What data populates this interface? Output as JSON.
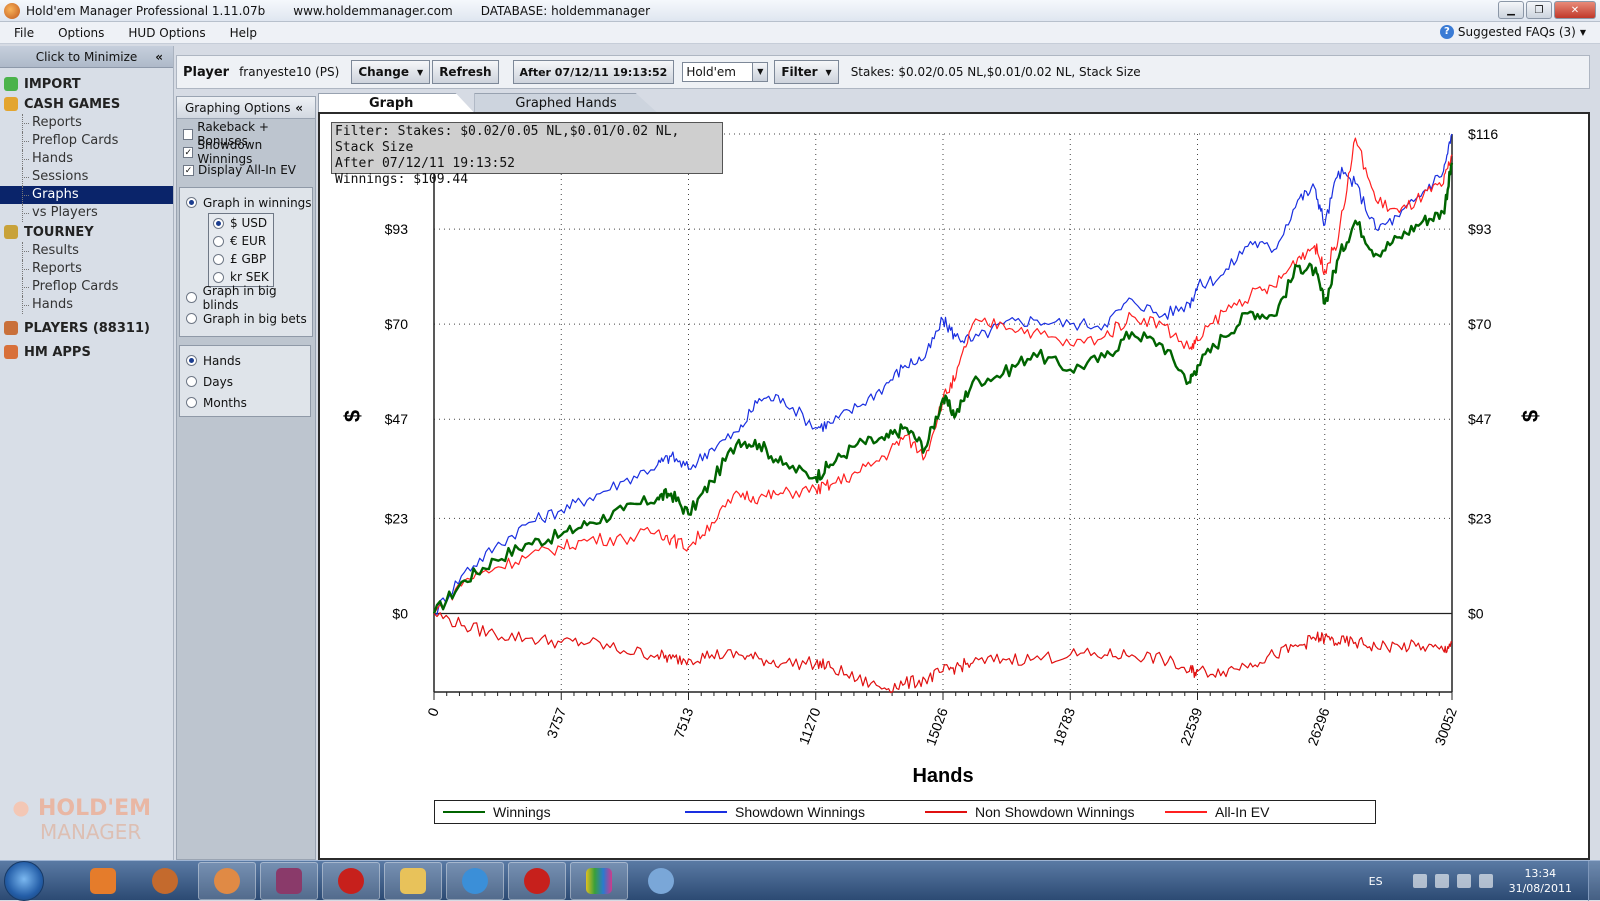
{
  "window": {
    "title": "Hold'em Manager Professional 1.11.07b",
    "website": "www.holdemmanager.com",
    "database": "DATABASE: holdemmanager"
  },
  "menu": {
    "items": [
      "File",
      "Options",
      "HUD Options",
      "Help"
    ],
    "faqs": "Suggested FAQs (3)"
  },
  "nav": {
    "minimize": "Click to Minimize",
    "import": "IMPORT",
    "cash_games": "CASH GAMES",
    "cash_items": [
      "Reports",
      "Preflop Cards",
      "Hands",
      "Sessions",
      "Graphs",
      "vs Players"
    ],
    "tourney": "TOURNEY",
    "tourney_items": [
      "Results",
      "Reports",
      "Preflop Cards",
      "Hands"
    ],
    "players": "PLAYERS (88311)",
    "hm_apps": "HM APPS",
    "logo_line1": "HOLD'EM",
    "logo_line2": "MANAGER"
  },
  "toolbar": {
    "player_label": "Player",
    "player_name": "franyeste10 (PS)",
    "change": "Change",
    "refresh": "Refresh",
    "date_filter": "After 07/12/11 19:13:52",
    "game": "Hold'em",
    "filter": "Filter",
    "stakes_text": "Stakes: $0.02/0.05 NL,$0.01/0.02 NL, Stack Size"
  },
  "graph_options": {
    "title": "Graphing Options",
    "checkboxes": [
      {
        "label": "Rakeback + Bonuses",
        "checked": false
      },
      {
        "label": "Showdown Winnings",
        "checked": true
      },
      {
        "label": "Display All-In EV",
        "checked": true
      }
    ],
    "graph_in_winnings": "Graph in winnings",
    "currencies": [
      "$ USD",
      "€ EUR",
      "£ GBP",
      "kr SEK"
    ],
    "graph_in_bb": "Graph in big blinds",
    "graph_in_bets": "Graph in big bets",
    "x_units": [
      "Hands",
      "Days",
      "Months"
    ]
  },
  "tabs": [
    "Graph",
    "Graphed Hands"
  ],
  "info_box": {
    "line1": "Filter: Stakes: $0.02/0.05 NL,$0.01/0.02 NL, Stack Size",
    "line2": "After 07/12/11 19:13:52",
    "line3": "Winnings: $109.44"
  },
  "chart_data": {
    "type": "line",
    "xlabel": "Hands",
    "ylabel": "$",
    "x_ticks": [
      0,
      3757,
      7513,
      11270,
      15026,
      18783,
      22539,
      26296,
      30052
    ],
    "y_ticks": [
      "$0",
      "$23",
      "$47",
      "$70",
      "$93",
      "$116"
    ],
    "y_tick_values": [
      0,
      23,
      47,
      70,
      93,
      116
    ],
    "xlim": [
      0,
      30052
    ],
    "ylim": [
      -19,
      116
    ],
    "grid": true,
    "legend_position": "bottom",
    "series": [
      {
        "name": "Winnings",
        "color": "#006400",
        "x": [
          0,
          900,
          1800,
          2800,
          3757,
          4600,
          5600,
          6600,
          7000,
          7513,
          8200,
          9000,
          9600,
          10300,
          11270,
          11700,
          12500,
          13300,
          13900,
          14500,
          15026,
          15400,
          15900,
          16800,
          17700,
          18783,
          19800,
          20600,
          21500,
          22300,
          22539,
          23300,
          24100,
          24800,
          25500,
          26000,
          26296,
          26700,
          27200,
          27800,
          28500,
          29200,
          29800,
          30052
        ],
        "y": [
          0,
          8,
          13,
          17,
          19,
          22,
          25,
          28,
          29,
          24,
          32,
          42,
          41,
          36,
          33,
          36,
          41,
          42,
          45,
          40,
          52,
          48,
          56,
          58,
          63,
          59,
          62,
          68,
          65,
          56,
          60,
          67,
          73,
          72,
          84,
          83,
          75,
          86,
          95,
          87,
          91,
          95,
          97,
          109
        ]
      },
      {
        "name": "Showdown Winnings",
        "color": "#1a2fe0",
        "x": [
          0,
          900,
          1800,
          2800,
          3757,
          4600,
          5600,
          6600,
          7000,
          7513,
          8200,
          9000,
          9600,
          10300,
          11270,
          11700,
          12500,
          13300,
          13900,
          14500,
          15026,
          15400,
          15900,
          16800,
          17700,
          18783,
          19800,
          20600,
          21500,
          22300,
          22539,
          23300,
          24100,
          24800,
          25500,
          26000,
          26296,
          26700,
          27200,
          27800,
          28500,
          29200,
          29800,
          30052
        ],
        "y": [
          0,
          10,
          16,
          22,
          25,
          28,
          32,
          36,
          38,
          35,
          40,
          44,
          52,
          52,
          45,
          46,
          50,
          55,
          60,
          62,
          71,
          67,
          66,
          70,
          71,
          70,
          70,
          76,
          72,
          75,
          79,
          82,
          90,
          88,
          100,
          103,
          94,
          107,
          104,
          93,
          96,
          102,
          107,
          116
        ]
      },
      {
        "name": "Non Showdown Winnings",
        "color": "#e01010",
        "x": [
          0,
          900,
          1800,
          2800,
          3757,
          4600,
          5600,
          6600,
          7000,
          7513,
          8200,
          9000,
          9600,
          10300,
          11270,
          11700,
          12500,
          13300,
          13900,
          14500,
          15026,
          15400,
          15900,
          16800,
          17700,
          18783,
          19800,
          20600,
          21500,
          22300,
          22539,
          23300,
          24100,
          24800,
          25500,
          26000,
          26296,
          26700,
          27200,
          27800,
          28500,
          29200,
          29800,
          30052
        ],
        "y": [
          0,
          -3,
          -5,
          -6,
          -7,
          -7,
          -9,
          -10,
          -11,
          -11,
          -10,
          -10,
          -11,
          -12,
          -12,
          -13,
          -16,
          -18,
          -17,
          -16,
          -14,
          -13,
          -12,
          -11,
          -11,
          -10,
          -10,
          -10,
          -11,
          -14,
          -14,
          -14,
          -12,
          -10,
          -8,
          -6,
          -6,
          -7,
          -7,
          -8,
          -8,
          -8,
          -9,
          -7
        ]
      },
      {
        "name": "All-In EV",
        "color": "#ff2020",
        "x": [
          0,
          900,
          1800,
          2800,
          3757,
          4600,
          5600,
          6600,
          7000,
          7513,
          8200,
          9000,
          9600,
          10300,
          11270,
          11700,
          12500,
          13300,
          13900,
          14500,
          15026,
          15400,
          15900,
          16800,
          17700,
          18783,
          19800,
          20600,
          21500,
          22300,
          22539,
          23300,
          24100,
          24800,
          25500,
          26000,
          26296,
          26700,
          27200,
          27800,
          28500,
          29200,
          29800,
          30052
        ],
        "y": [
          0,
          8,
          11,
          14,
          16,
          18,
          18,
          20,
          18,
          16,
          22,
          29,
          28,
          29,
          30,
          31,
          34,
          38,
          43,
          38,
          52,
          57,
          70,
          70,
          68,
          65,
          67,
          72,
          70,
          64,
          66,
          73,
          77,
          79,
          86,
          89,
          83,
          91,
          115,
          100,
          97,
          101,
          104,
          111
        ]
      }
    ]
  },
  "taskbar": {
    "lang": "ES",
    "time": "13:34",
    "date": "31/08/2011"
  }
}
